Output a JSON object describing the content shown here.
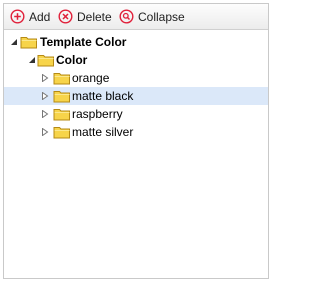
{
  "toolbar": {
    "add_label": "Add",
    "delete_label": "Delete",
    "collapse_label": "Collapse",
    "accent_color": "#e0203a"
  },
  "tree": {
    "root": {
      "label": "Template Color",
      "expanded": true
    },
    "group": {
      "label": "Color",
      "expanded": true
    },
    "items": [
      {
        "label": "orange",
        "selected": false
      },
      {
        "label": "matte black",
        "selected": true
      },
      {
        "label": "raspberry",
        "selected": false
      },
      {
        "label": "matte silver",
        "selected": false
      }
    ],
    "selection_color": "#dbe8f9",
    "folder_color": "#f7d44a"
  }
}
